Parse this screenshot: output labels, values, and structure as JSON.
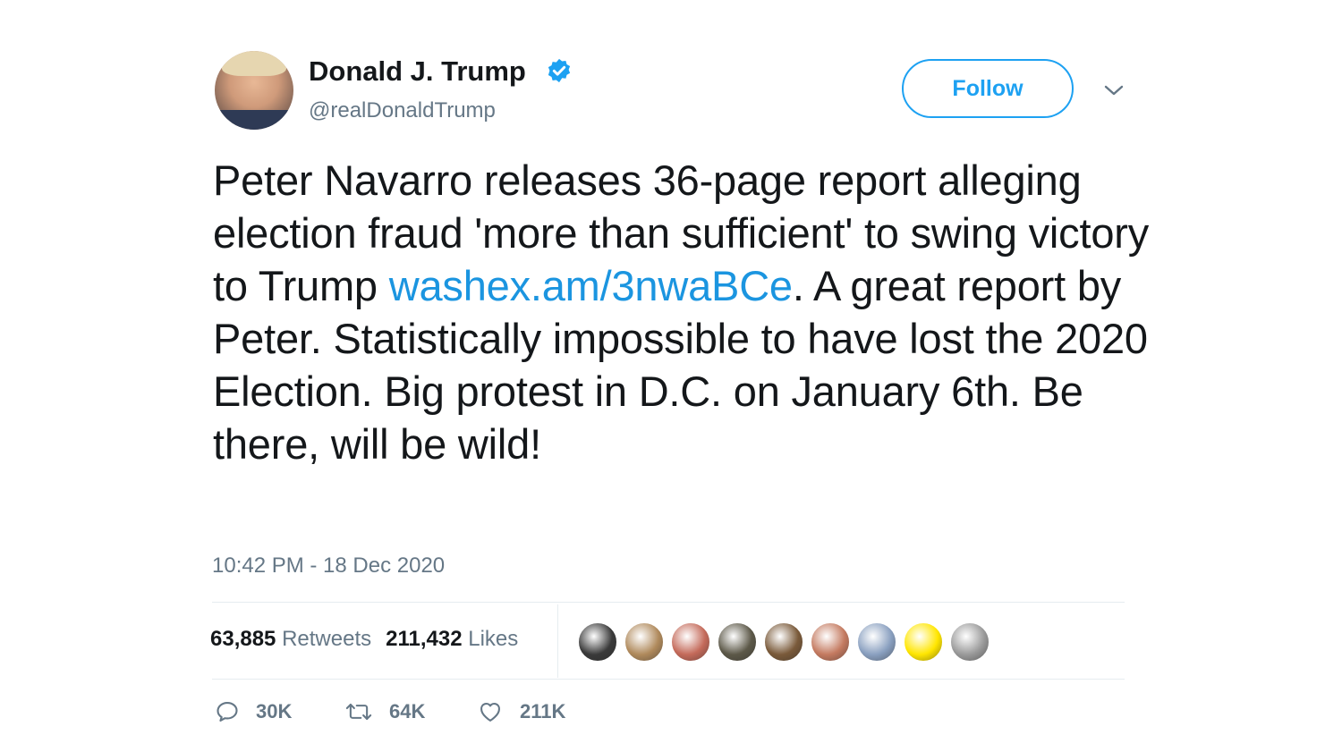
{
  "author": {
    "name": "Donald J. Trump",
    "handle": "@realDonaldTrump",
    "verified": true
  },
  "follow_label": "Follow",
  "tweet": {
    "text_before_link": "Peter Navarro releases 36-page report alleging election fraud 'more than sufficient' to swing victory to Trump",
    "link": "washex.am/3nwaBCe",
    "text_after_link": ". A great report by Peter. Statistically impossible to have lost the 2020 Election. Big protest in D.C. on January 6th. Be there, will be wild!",
    "timestamp": "10:42 PM - 18 Dec 2020"
  },
  "stats": {
    "retweets_count": "63,885",
    "retweets_label": "Retweets",
    "likes_count": "211,432",
    "likes_label": "Likes"
  },
  "actions": {
    "reply_count": "30K",
    "retweet_count": "64K",
    "like_count": "211K"
  },
  "colors": {
    "accent": "#1da1f2",
    "link": "#1b95e0",
    "muted": "#657786",
    "text": "#14171a",
    "divider": "#e6ecf0"
  },
  "icons": {
    "verified": "verified-badge-icon",
    "chevron": "chevron-down-icon",
    "reply": "reply-icon",
    "retweet": "retweet-icon",
    "like": "heart-icon"
  },
  "likers": [
    {
      "color": "#3a3a3a"
    },
    {
      "color": "#b08a5c"
    },
    {
      "color": "#c46a5a"
    },
    {
      "color": "#5c5848"
    },
    {
      "color": "#7a5a3a"
    },
    {
      "color": "#c47a60"
    },
    {
      "color": "#8aa0c0"
    },
    {
      "color": "#ffe600"
    },
    {
      "color": "#9a9a9a"
    }
  ]
}
